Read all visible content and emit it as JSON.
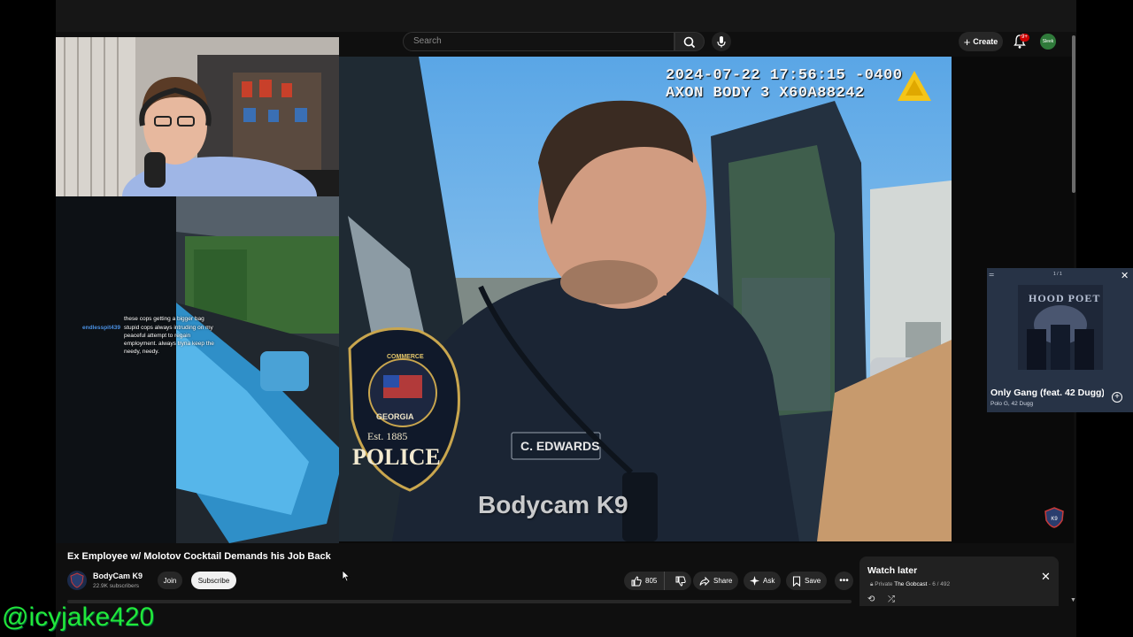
{
  "overlay": {
    "streamer_handle": "@icyjake420"
  },
  "masthead": {
    "search_placeholder": "Search",
    "create_label": "Create",
    "notification_count": "9+",
    "avatar_label": "Sleek"
  },
  "video": {
    "bodycam_timestamp": "2024-07-22 17:56:15 -0400",
    "bodycam_device": "AXON BODY 3 X60A88242",
    "watermark": "Bodycam K9",
    "badge_top": "COMMERCE",
    "badge_mid": "GEORGIA",
    "badge_year": "Est. 1885",
    "badge_bottom": "POLICE",
    "nameplate": "C. EDWARDS"
  },
  "chat": {
    "messages": [
      {
        "user": "",
        "text": "these cops getting a bigger bag",
        "user_color": "#d93030"
      },
      {
        "user": "endlesspit439",
        "text": "stupid cops always intruding on my peaceful attempt to regain employment. always tryna keep the needy, needy.",
        "user_color": "#4a90e2"
      }
    ]
  },
  "mini_player": {
    "counter": "1 / 1",
    "track_title": "Only Gang (feat. 42 Dugg)",
    "track_artist": "Polo G, 42 Dugg",
    "album_art_text": "HOOD POET"
  },
  "watch_page": {
    "title": "Ex Employee w/ Molotov Cocktail Demands his Job Back",
    "channel_name": "BodyCam K9",
    "subscribers": "22.9K subscribers",
    "join_label": "Join",
    "subscribe_label": "Subscribe",
    "like_count": "805",
    "share_label": "Share",
    "ask_label": "Ask",
    "save_label": "Save",
    "more_label": "•••"
  },
  "watch_later": {
    "title": "Watch later",
    "privacy": "Private",
    "owner": "The Gobcast",
    "position": "- 6 / 492"
  },
  "colors": {
    "handle_green": "#22e83a",
    "subscribe_bg": "#f1f1f1",
    "notification_red": "#cc0000",
    "mini_player_bg": "#273346"
  }
}
